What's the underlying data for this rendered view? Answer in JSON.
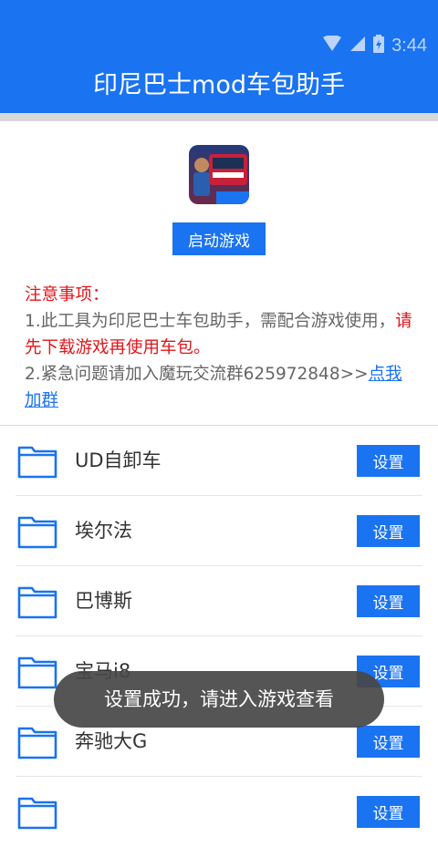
{
  "status_bar": {
    "time": "3:44",
    "icons": [
      "wifi-icon",
      "signal-icon",
      "battery-charging-icon"
    ]
  },
  "header": {
    "title": "印尼巴士mod车包助手"
  },
  "app": {
    "icon_label": "车包助手",
    "launch_label": "启动游戏"
  },
  "notes": {
    "heading": "注意事项：",
    "line1_pre": "1.此工具为印尼巴士车包助手，需配合游戏使用，",
    "line1_red": "请先下载游戏再使用车包。",
    "line2_pre": "2.紧急问题请加入魔玩交流群625972848>>",
    "line2_link": "点我加群"
  },
  "list": {
    "items": [
      {
        "name": "UD自卸车",
        "button": "设置"
      },
      {
        "name": "埃尔法",
        "button": "设置"
      },
      {
        "name": "巴博斯",
        "button": "设置"
      },
      {
        "name": "宝马i8",
        "button": "设置"
      },
      {
        "name": "奔驰大G",
        "button": "设置"
      },
      {
        "name": "",
        "button": "设置"
      }
    ]
  },
  "toast": {
    "text": "设置成功，请进入游戏查看"
  },
  "colors": {
    "primary": "#1a73f0",
    "warning": "#e0161b",
    "text": "#333333",
    "muted": "#666666"
  }
}
